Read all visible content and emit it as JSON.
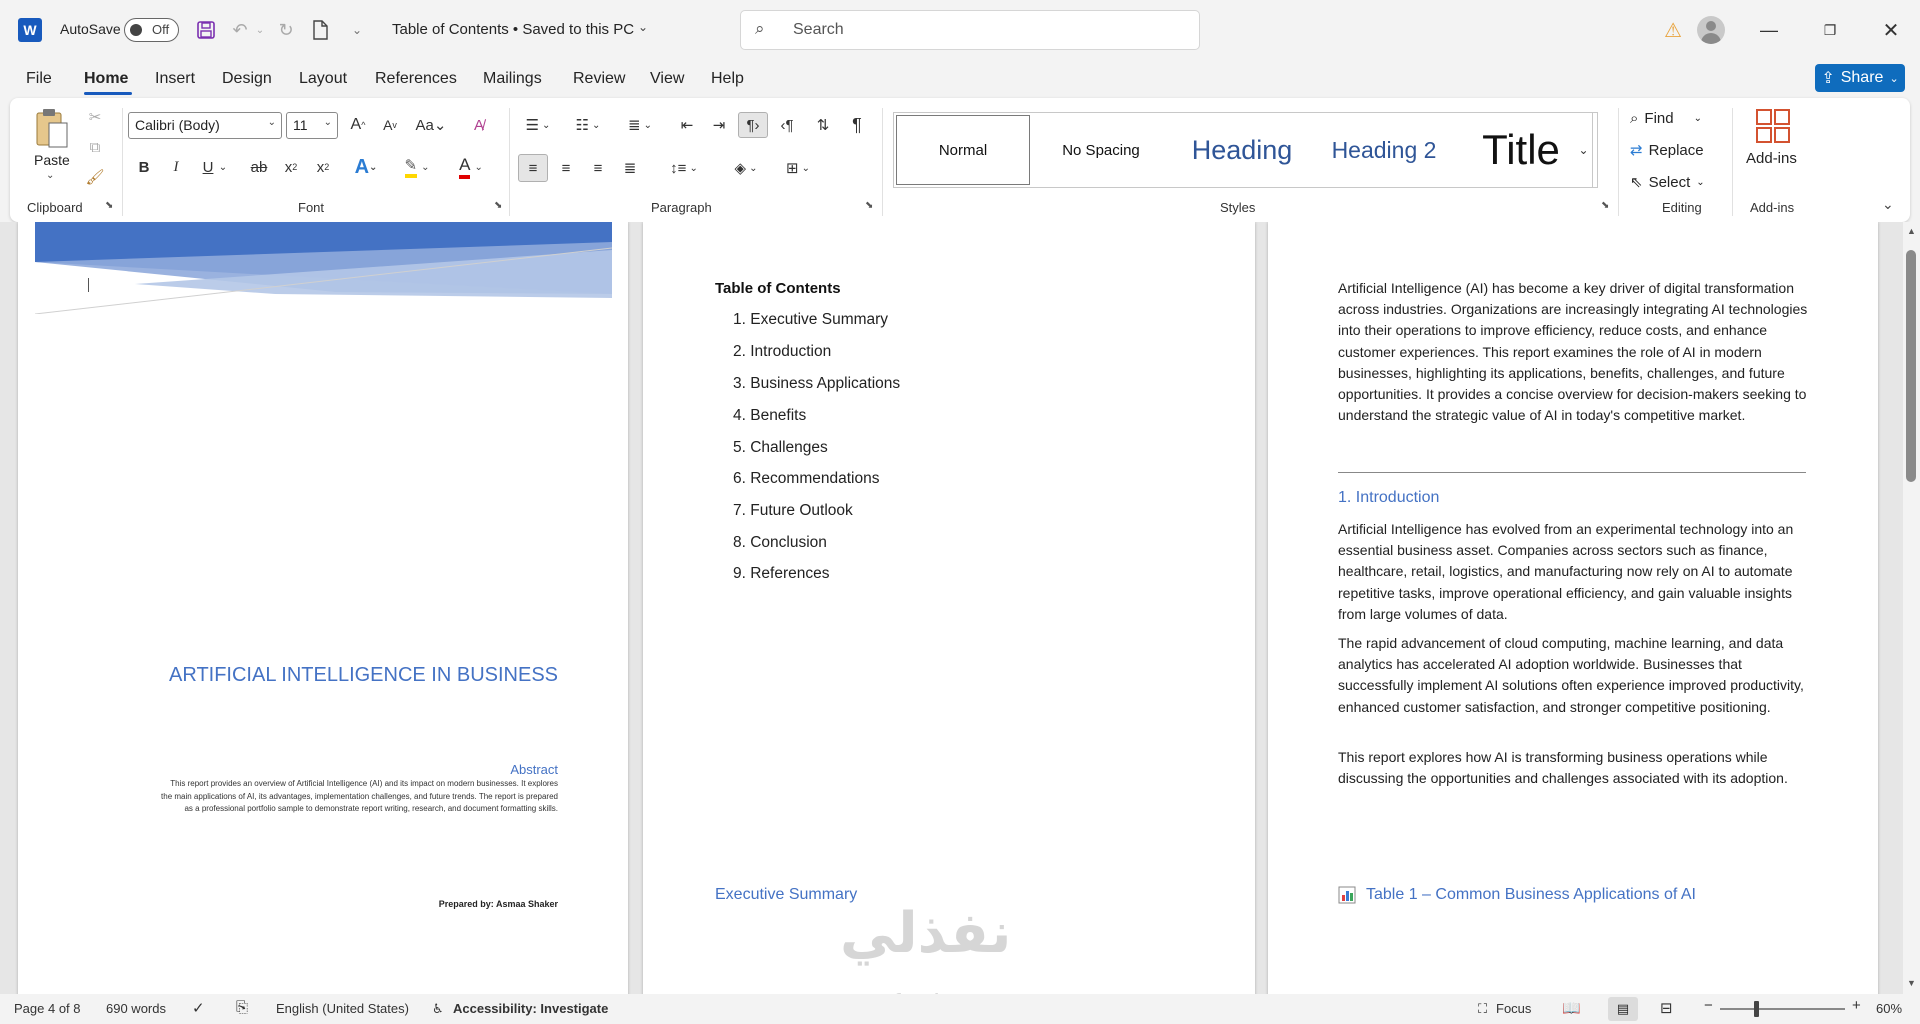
{
  "titlebar": {
    "autosave_label": "AutoSave",
    "autosave_state": "Off",
    "doc_title": "Table of Contents • Saved to this PC",
    "search_placeholder": "Search"
  },
  "tabs": [
    "File",
    "Home",
    "Insert",
    "Design",
    "Layout",
    "References",
    "Mailings",
    "Review",
    "View",
    "Help"
  ],
  "active_tab": "Home",
  "share_label": "Share",
  "ribbon": {
    "clipboard": {
      "paste": "Paste",
      "label": "Clipboard"
    },
    "font": {
      "family": "Calibri (Body)",
      "size": "11",
      "label": "Font"
    },
    "paragraph": {
      "label": "Paragraph"
    },
    "styles": {
      "items": [
        "Normal",
        "No Spacing",
        "Heading",
        "Heading 2",
        "Title"
      ],
      "label": "Styles"
    },
    "editing": {
      "find": "Find",
      "replace": "Replace",
      "select": "Select",
      "label": "Editing"
    },
    "addins": {
      "button": "Add-ins",
      "label": "Add-ins"
    }
  },
  "cover_page": {
    "title": "ARTIFICIAL INTELLIGENCE IN BUSINESS",
    "abstract_heading": "Abstract",
    "abstract_text": "This report provides an overview of Artificial Intelligence (AI) and its impact on modern businesses. It explores the main applications of AI, its advantages, implementation challenges, and future trends. The report is prepared as a professional portfolio sample to demonstrate report writing, research, and document formatting skills.",
    "prepared_by": "Prepared by: Asmaa Shaker"
  },
  "toc_page": {
    "heading": "Table of Contents",
    "items": [
      "1. Executive Summary",
      "2. Introduction",
      "3. Business Applications",
      "4. Benefits",
      "5. Challenges",
      "6. Recommendations",
      "7. Future Outlook",
      "8. Conclusion",
      "9. References"
    ],
    "next_heading": "Executive Summary"
  },
  "intro_page": {
    "summary_paragraph": "Artificial Intelligence (AI) has become a key driver of digital transformation across industries. Organizations are increasingly integrating AI technologies into their operations to improve efficiency, reduce costs, and enhance customer experiences. This report examines the role of AI in modern businesses, highlighting its applications, benefits, challenges, and future opportunities. It provides a concise overview for decision-makers seeking to understand the strategic value of AI in today's competitive market.",
    "intro_heading": "1. Introduction",
    "intro_p1": "Artificial Intelligence has evolved from an experimental technology into an essential business asset. Companies across sectors such as finance, healthcare, retail, logistics, and manufacturing now rely on AI to automate repetitive tasks, improve operational efficiency, and gain valuable insights from large volumes of data.",
    "intro_p2": "The rapid advancement of cloud computing, machine learning, and data analytics has accelerated AI adoption worldwide. Businesses that successfully implement AI solutions often experience improved productivity, enhanced customer satisfaction, and stronger competitive positioning.",
    "intro_p3": "This report explores how AI is transforming business operations while discussing the opportunities and challenges associated with its adoption.",
    "table_heading": "Table 1 – Common Business Applications of AI"
  },
  "watermark": {
    "arabic": "نفذلي",
    "url": "nafezly.com"
  },
  "statusbar": {
    "page": "Page 4 of 8",
    "words": "690 words",
    "language": "English (United States)",
    "accessibility": "Accessibility: Investigate",
    "focus": "Focus",
    "zoom": "60%"
  },
  "colors": {
    "accent": "#185abd",
    "heading_blue": "#4472c4",
    "share": "#0f6cbd"
  }
}
